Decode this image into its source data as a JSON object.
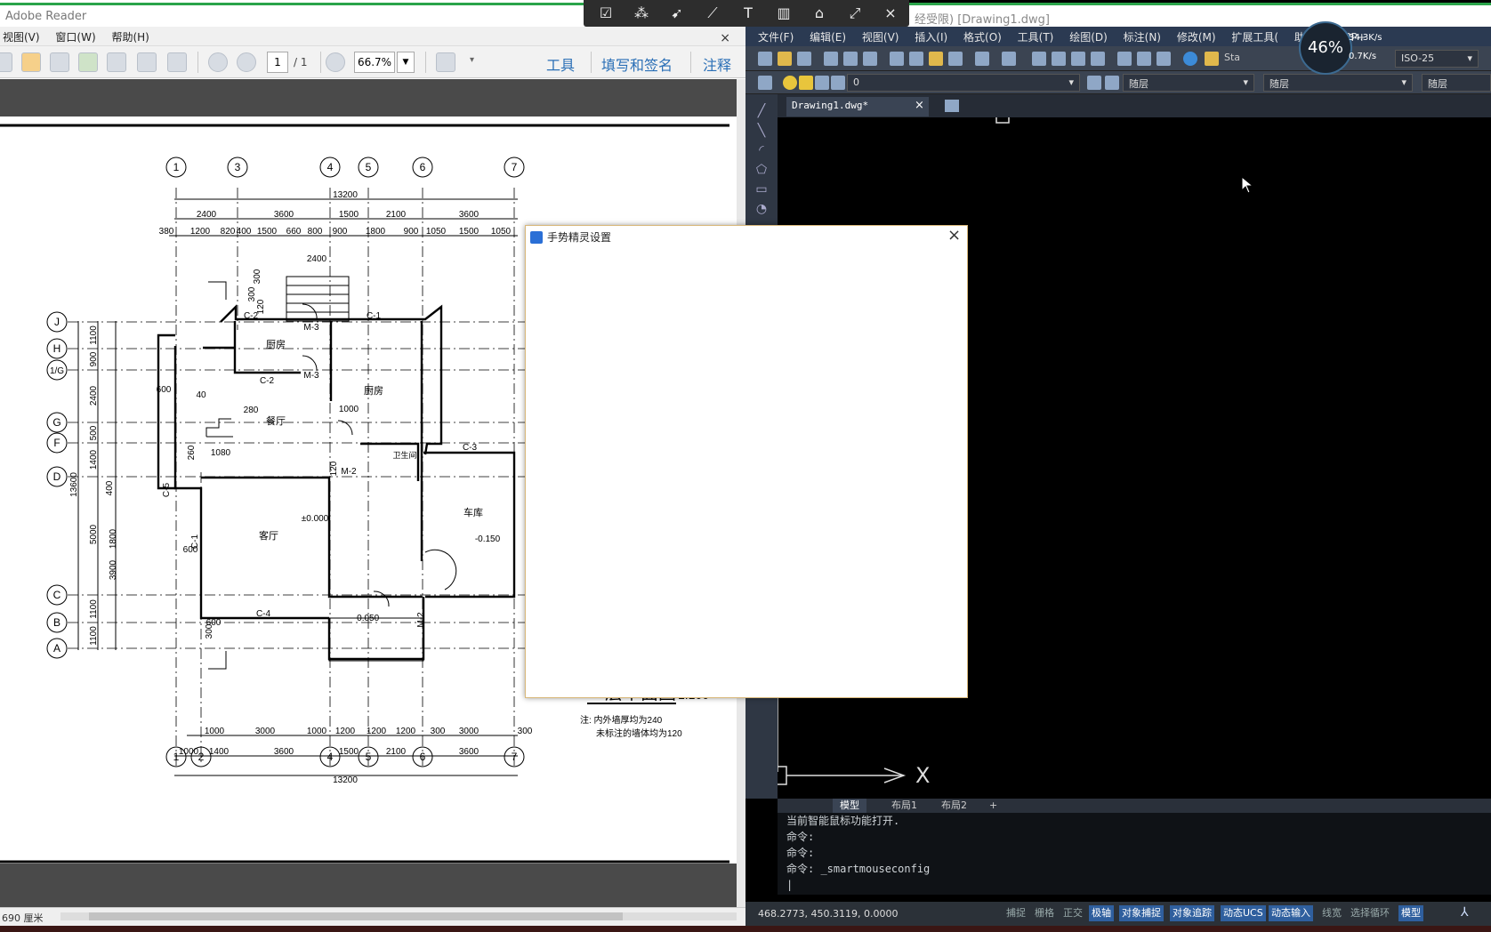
{
  "reader": {
    "title": "Adobe Reader",
    "menu": [
      "视图(V)",
      "窗口(W)",
      "帮助(H)"
    ],
    "close": "×",
    "page_current": "1",
    "page_total": "/ 1",
    "zoom": "66.7%",
    "links": [
      "工具",
      "填写和签名",
      "注释"
    ],
    "status_size": "690 厘米"
  },
  "drawing": {
    "title": "一层平面图",
    "scale": "1:100",
    "notes": [
      "注: 内外墙厚均为240",
      "未标注的墙体均为120"
    ],
    "top_axes": [
      "1",
      "3",
      "4",
      "5",
      "6",
      "7"
    ],
    "bottom_axes": [
      "1",
      "2",
      "4",
      "5",
      "6",
      "7"
    ],
    "left_axes": [
      "J",
      "H",
      "1/G",
      "G",
      "F",
      "D",
      "C",
      "B",
      "A"
    ],
    "top_dims_1": [
      "2400",
      "3600",
      "1500",
      "2100",
      "3600"
    ],
    "top_dims_2": [
      "380",
      "1200",
      "820",
      "400",
      "1500",
      "660",
      "800",
      "900",
      "1800",
      "900",
      "1050",
      "1500",
      "1050"
    ],
    "overall": "13200",
    "bottom_dims_1": [
      "1000",
      "3000",
      "1000",
      "1200",
      "1200",
      "1200",
      "300",
      "3000",
      "300"
    ],
    "bottom_dims_2": [
      "1000",
      "1400",
      "3600",
      "1500",
      "2100",
      "3600"
    ],
    "left_dims": [
      "1100",
      "900",
      "2400",
      "500",
      "1400",
      "400",
      "5000",
      "3900",
      "1100",
      "1100"
    ],
    "left_total": "13600",
    "rooms": [
      {
        "name": "厨房"
      },
      {
        "name": "厨房"
      },
      {
        "name": "餐厅"
      },
      {
        "name": "卫生间"
      },
      {
        "name": "客厅"
      },
      {
        "name": "车库"
      }
    ],
    "levels": [
      "±0.000",
      "-0.150",
      "-0.050"
    ],
    "labels": [
      "C-2",
      "C-1",
      "M-3",
      "M-3",
      "C-2",
      "M-2",
      "C-5",
      "C-1",
      "C-4",
      "C-3",
      "M-2",
      "600",
      "600",
      "600",
      "40",
      "280",
      "1080",
      "1000",
      "2400",
      "300",
      "300",
      "120",
      "260",
      "120",
      "300",
      "1800"
    ]
  },
  "float_toolbar": {
    "icons": [
      "checkbox-icon",
      "select-icon",
      "move-icon",
      "line-edit-icon",
      "text-icon",
      "delete-icon",
      "trash-icon",
      "expand-icon",
      "close-icon"
    ],
    "close": "×"
  },
  "cad": {
    "title": "[Drawing1.dwg]",
    "title_prefix": "经受限)",
    "menu": [
      "文件(F)",
      "编辑(E)",
      "视图(V)",
      "插入(I)",
      "格式(O)",
      "工具(T)",
      "绘图(D)",
      "标注(N)",
      "修改(M)",
      "扩展工具(",
      "助(H)",
      "APP+"
    ],
    "gauge": "46%",
    "net_up": "34.3K/s",
    "net_down": "0.7K/s",
    "style_sel": "Sta",
    "dim_sel": "ISO-25",
    "layer": "0",
    "color_sel": "随层",
    "linetype_sel": "随层",
    "lineweight_sel": "随层",
    "doc_tab": "Drawing1.dwg*",
    "doc_tab_close": "×",
    "ucs_x": "X",
    "layout_tabs": [
      "模型",
      "布局1",
      "布局2",
      "+"
    ],
    "command_lines": [
      "当前智能鼠标功能打开.",
      "命令:",
      "命令:",
      "命令: _smartmouseconfig"
    ],
    "coords": "468.2773, 450.3119, 0.0000",
    "status_buttons": [
      {
        "label": "捕捉",
        "on": false
      },
      {
        "label": "栅格",
        "on": false
      },
      {
        "label": "正交",
        "on": false
      },
      {
        "label": "极轴",
        "on": true
      },
      {
        "label": "对象捕捉",
        "on": true
      },
      {
        "label": "对象追踪",
        "on": true
      },
      {
        "label": "动态UCS",
        "on": true
      },
      {
        "label": "动态输入",
        "on": true
      },
      {
        "label": "线宽",
        "on": false
      },
      {
        "label": "选择循环",
        "on": false
      },
      {
        "label": "模型",
        "on": true
      }
    ]
  },
  "dialog": {
    "title": "手势精灵设置",
    "close": "×"
  }
}
